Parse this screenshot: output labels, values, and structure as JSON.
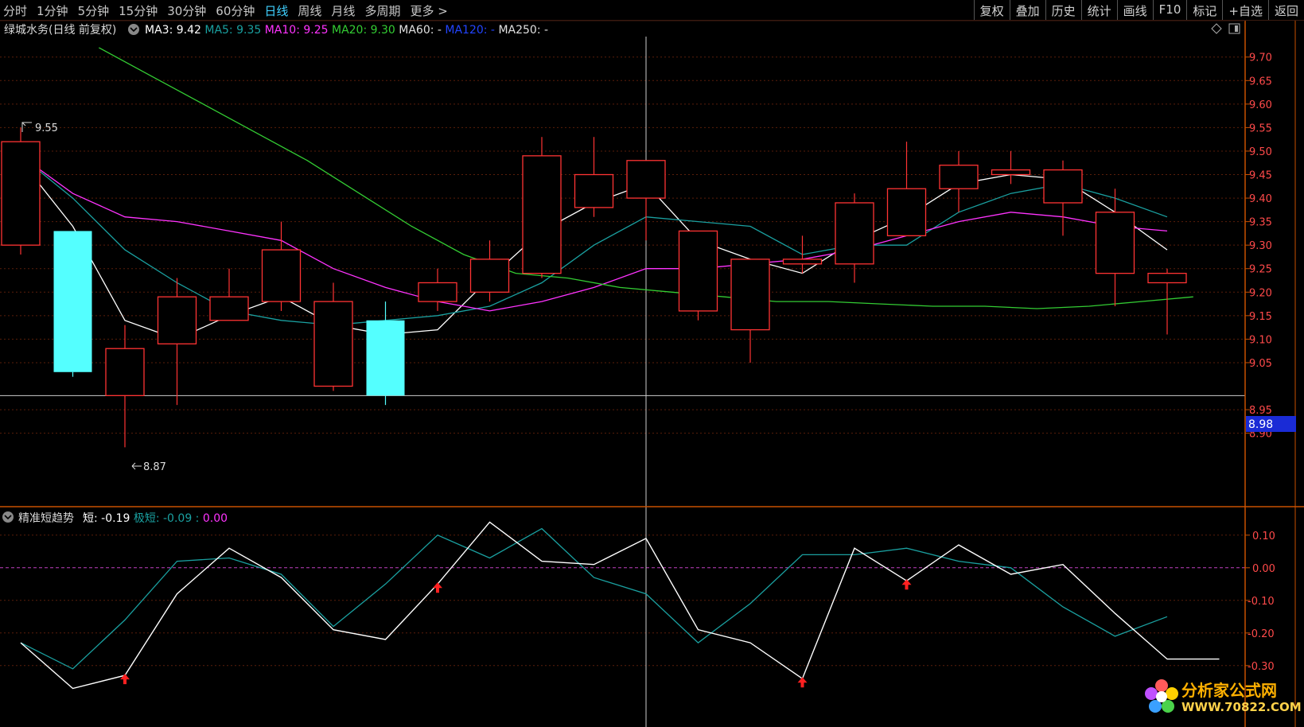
{
  "toolbar": {
    "periods": [
      "分时",
      "1分钟",
      "5分钟",
      "15分钟",
      "30分钟",
      "60分钟",
      "日线",
      "周线",
      "月线",
      "多周期",
      "更多 >"
    ],
    "active_period": "日线",
    "tools": [
      "复权",
      "叠加",
      "历史",
      "统计",
      "画线",
      "F10",
      "标记",
      "+自选",
      "返回"
    ]
  },
  "main_header": {
    "stock_name": "绿城水务(日线 前复权)",
    "items": [
      {
        "label": "MA3:",
        "value": "9.42",
        "color": "#ffffff"
      },
      {
        "label": "MA5:",
        "value": "9.35",
        "color": "#1aa0a0"
      },
      {
        "label": "MA10:",
        "value": "9.25",
        "color": "#ff33ff"
      },
      {
        "label": "MA20:",
        "value": "9.30",
        "color": "#33cc33"
      },
      {
        "label": "MA60:",
        "value": "-",
        "color": "#e0e0e0"
      },
      {
        "label": "MA120:",
        "value": "-",
        "color": "#2244ff"
      },
      {
        "label": "MA250:",
        "value": "-",
        "color": "#e0e0e0"
      }
    ]
  },
  "sub_header": {
    "indicator_name": "精准短趋势",
    "short_label": "短:",
    "short_value": "-0.19",
    "long_label": "极短:",
    "long_value": "-0.09",
    "extra_value": "0.00"
  },
  "annotations": {
    "high_label": "9.55",
    "low_label": "8.87",
    "crosshair_price": "8.98"
  },
  "price_axis": {
    "ticks": [
      "9.70",
      "9.65",
      "9.60",
      "9.55",
      "9.50",
      "9.45",
      "9.40",
      "9.35",
      "9.30",
      "9.25",
      "9.20",
      "9.15",
      "9.10",
      "9.05",
      "8.95",
      "8.90"
    ]
  },
  "indicator_axis": {
    "ticks": [
      "0.10",
      "0.00",
      "-0.10",
      "-0.20",
      "-0.30"
    ]
  },
  "colors": {
    "up": "#ff3333",
    "down": "#54ffff",
    "grid": "#5a1e0a",
    "axis": "#c85000"
  },
  "chart_data": {
    "type": "candlestick",
    "candles": [
      {
        "o": 9.3,
        "h": 9.55,
        "l": 9.28,
        "c": 9.52
      },
      {
        "o": 9.33,
        "h": 9.33,
        "l": 9.02,
        "c": 9.03
      },
      {
        "o": 8.98,
        "h": 9.13,
        "l": 8.87,
        "c": 9.08
      },
      {
        "o": 9.09,
        "h": 9.23,
        "l": 8.96,
        "c": 9.19
      },
      {
        "o": 9.14,
        "h": 9.25,
        "l": 9.14,
        "c": 9.19
      },
      {
        "o": 9.18,
        "h": 9.35,
        "l": 9.16,
        "c": 9.29
      },
      {
        "o": 9.0,
        "h": 9.22,
        "l": 8.99,
        "c": 9.18
      },
      {
        "o": 9.14,
        "h": 9.18,
        "l": 8.96,
        "c": 8.98
      },
      {
        "o": 9.18,
        "h": 9.25,
        "l": 9.16,
        "c": 9.22
      },
      {
        "o": 9.2,
        "h": 9.31,
        "l": 9.18,
        "c": 9.27
      },
      {
        "o": 9.24,
        "h": 9.53,
        "l": 9.23,
        "c": 9.49
      },
      {
        "o": 9.38,
        "h": 9.53,
        "l": 9.36,
        "c": 9.45
      },
      {
        "o": 9.4,
        "h": 9.48,
        "l": 9.31,
        "c": 9.48
      },
      {
        "o": 9.16,
        "h": 9.33,
        "l": 9.14,
        "c": 9.33
      },
      {
        "o": 9.12,
        "h": 9.27,
        "l": 9.05,
        "c": 9.27
      },
      {
        "o": 9.26,
        "h": 9.32,
        "l": 9.24,
        "c": 9.27
      },
      {
        "o": 9.26,
        "h": 9.41,
        "l": 9.22,
        "c": 9.39
      },
      {
        "o": 9.32,
        "h": 9.52,
        "l": 9.32,
        "c": 9.42
      },
      {
        "o": 9.42,
        "h": 9.5,
        "l": 9.37,
        "c": 9.47
      },
      {
        "o": 9.45,
        "h": 9.5,
        "l": 9.43,
        "c": 9.46
      },
      {
        "o": 9.39,
        "h": 9.48,
        "l": 9.32,
        "c": 9.46
      },
      {
        "o": 9.24,
        "h": 9.42,
        "l": 9.17,
        "c": 9.37
      },
      {
        "o": 9.22,
        "h": 9.25,
        "l": 9.11,
        "c": 9.24
      }
    ],
    "ma": [
      {
        "name": "MA3",
        "color": "#ffffff",
        "start": 0,
        "values": [
          9.48,
          9.34,
          9.14,
          9.1,
          9.15,
          9.19,
          9.13,
          9.11,
          9.12,
          9.23,
          9.33,
          9.39,
          9.43,
          9.31,
          9.27,
          9.24,
          9.31,
          9.36,
          9.43,
          9.45,
          9.44,
          9.37,
          9.29
        ]
      },
      {
        "name": "MA5",
        "color": "#1aa0a0",
        "start": 0,
        "values": [
          9.49,
          9.4,
          9.29,
          9.22,
          9.16,
          9.14,
          9.13,
          9.14,
          9.15,
          9.17,
          9.22,
          9.3,
          9.36,
          9.35,
          9.34,
          9.28,
          9.3,
          9.3,
          9.37,
          9.41,
          9.43,
          9.4,
          9.36
        ]
      },
      {
        "name": "MA10",
        "color": "#ff33ff",
        "start": 0,
        "values": [
          9.49,
          9.41,
          9.36,
          9.35,
          9.33,
          9.31,
          9.25,
          9.21,
          9.18,
          9.16,
          9.18,
          9.21,
          9.25,
          9.25,
          9.26,
          9.27,
          9.29,
          9.32,
          9.35,
          9.37,
          9.36,
          9.34,
          9.33
        ]
      },
      {
        "name": "MA20",
        "color": "#33cc33",
        "start": 1.5,
        "values": [
          9.72,
          9.66,
          9.6,
          9.54,
          9.48,
          9.41,
          9.34,
          9.28,
          9.24,
          9.23,
          9.21,
          9.2,
          9.19,
          9.18,
          9.18,
          9.175,
          9.17,
          9.17,
          9.165,
          9.17,
          9.18,
          9.19
        ]
      }
    ],
    "indicator": {
      "short": [
        -0.23,
        -0.37,
        -0.33,
        -0.08,
        0.06,
        -0.03,
        -0.19,
        -0.22,
        -0.05,
        0.14,
        0.02,
        0.01,
        0.09,
        -0.19,
        -0.23,
        -0.34,
        0.06,
        -0.04,
        0.07,
        -0.02,
        0.01,
        -0.14,
        -0.28,
        -0.28
      ],
      "long": [
        -0.23,
        -0.31,
        -0.16,
        0.02,
        0.03,
        -0.02,
        -0.18,
        -0.05,
        0.1,
        0.03,
        0.12,
        -0.03,
        -0.08,
        -0.23,
        -0.11,
        0.04,
        0.04,
        0.06,
        0.02,
        0.0,
        -0.12,
        -0.21,
        -0.15
      ],
      "signals": [
        2,
        8,
        15,
        17
      ]
    },
    "price_ylim": [
      8.83,
      9.73
    ],
    "indicator_ylim": [
      -0.42,
      0.18
    ]
  }
}
